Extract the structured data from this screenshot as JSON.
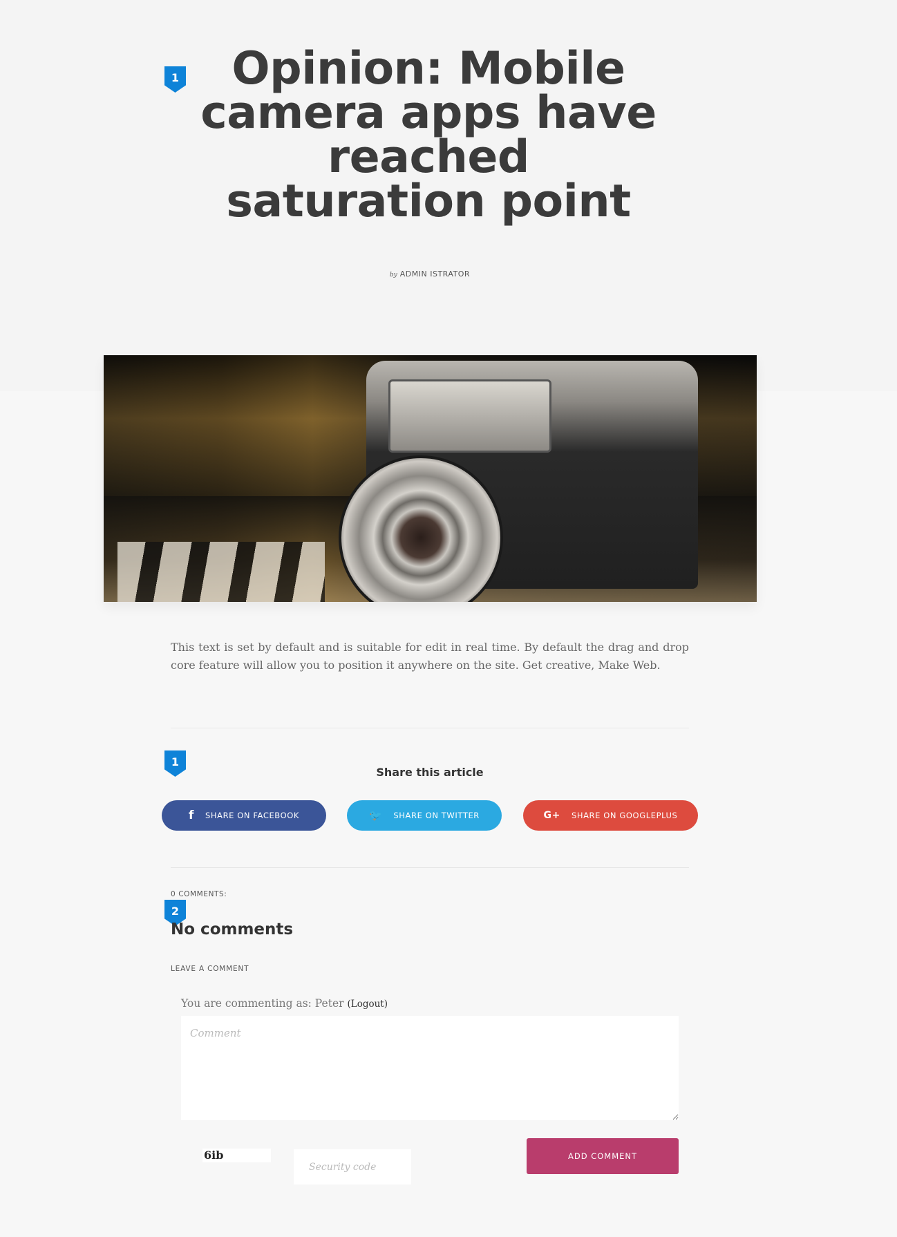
{
  "article": {
    "badge": "1",
    "title": "Opinion: Mobile camera apps have reached saturation point",
    "by_prefix": "by",
    "author": "ADMIN ISTRATOR",
    "body": "This text is set by default and is suitable for edit in real time. By default the drag and drop core feature will allow you to position it anywhere on the site. Get creative, Make Web."
  },
  "share": {
    "badge": "1",
    "title": "Share this article",
    "buttons": [
      {
        "label": "SHARE ON FACEBOOK",
        "icon": "f",
        "icon_name": "facebook-icon",
        "color": "#3b5598"
      },
      {
        "label": "SHARE ON TWITTER",
        "icon": "🐦",
        "icon_name": "twitter-icon",
        "color": "#2ba9e1"
      },
      {
        "label": "SHARE ON GOOGLEPLUS",
        "icon": "G+",
        "icon_name": "googleplus-icon",
        "color": "#dd4b3e"
      }
    ]
  },
  "comments": {
    "count_label": "0 COMMENTS:",
    "badge": "2",
    "empty_title": "No comments",
    "leave_label": "LEAVE A COMMENT",
    "commenting_as": "You are commenting as: Peter",
    "logout": "(Logout)",
    "comment_placeholder": "Comment",
    "captcha_text": "6ib",
    "security_placeholder": "Security code",
    "submit_label": "ADD COMMENT",
    "submit_color": "#b93d6c"
  },
  "colors": {
    "badge": "#0e83d8",
    "background": "#f7f7f7"
  }
}
